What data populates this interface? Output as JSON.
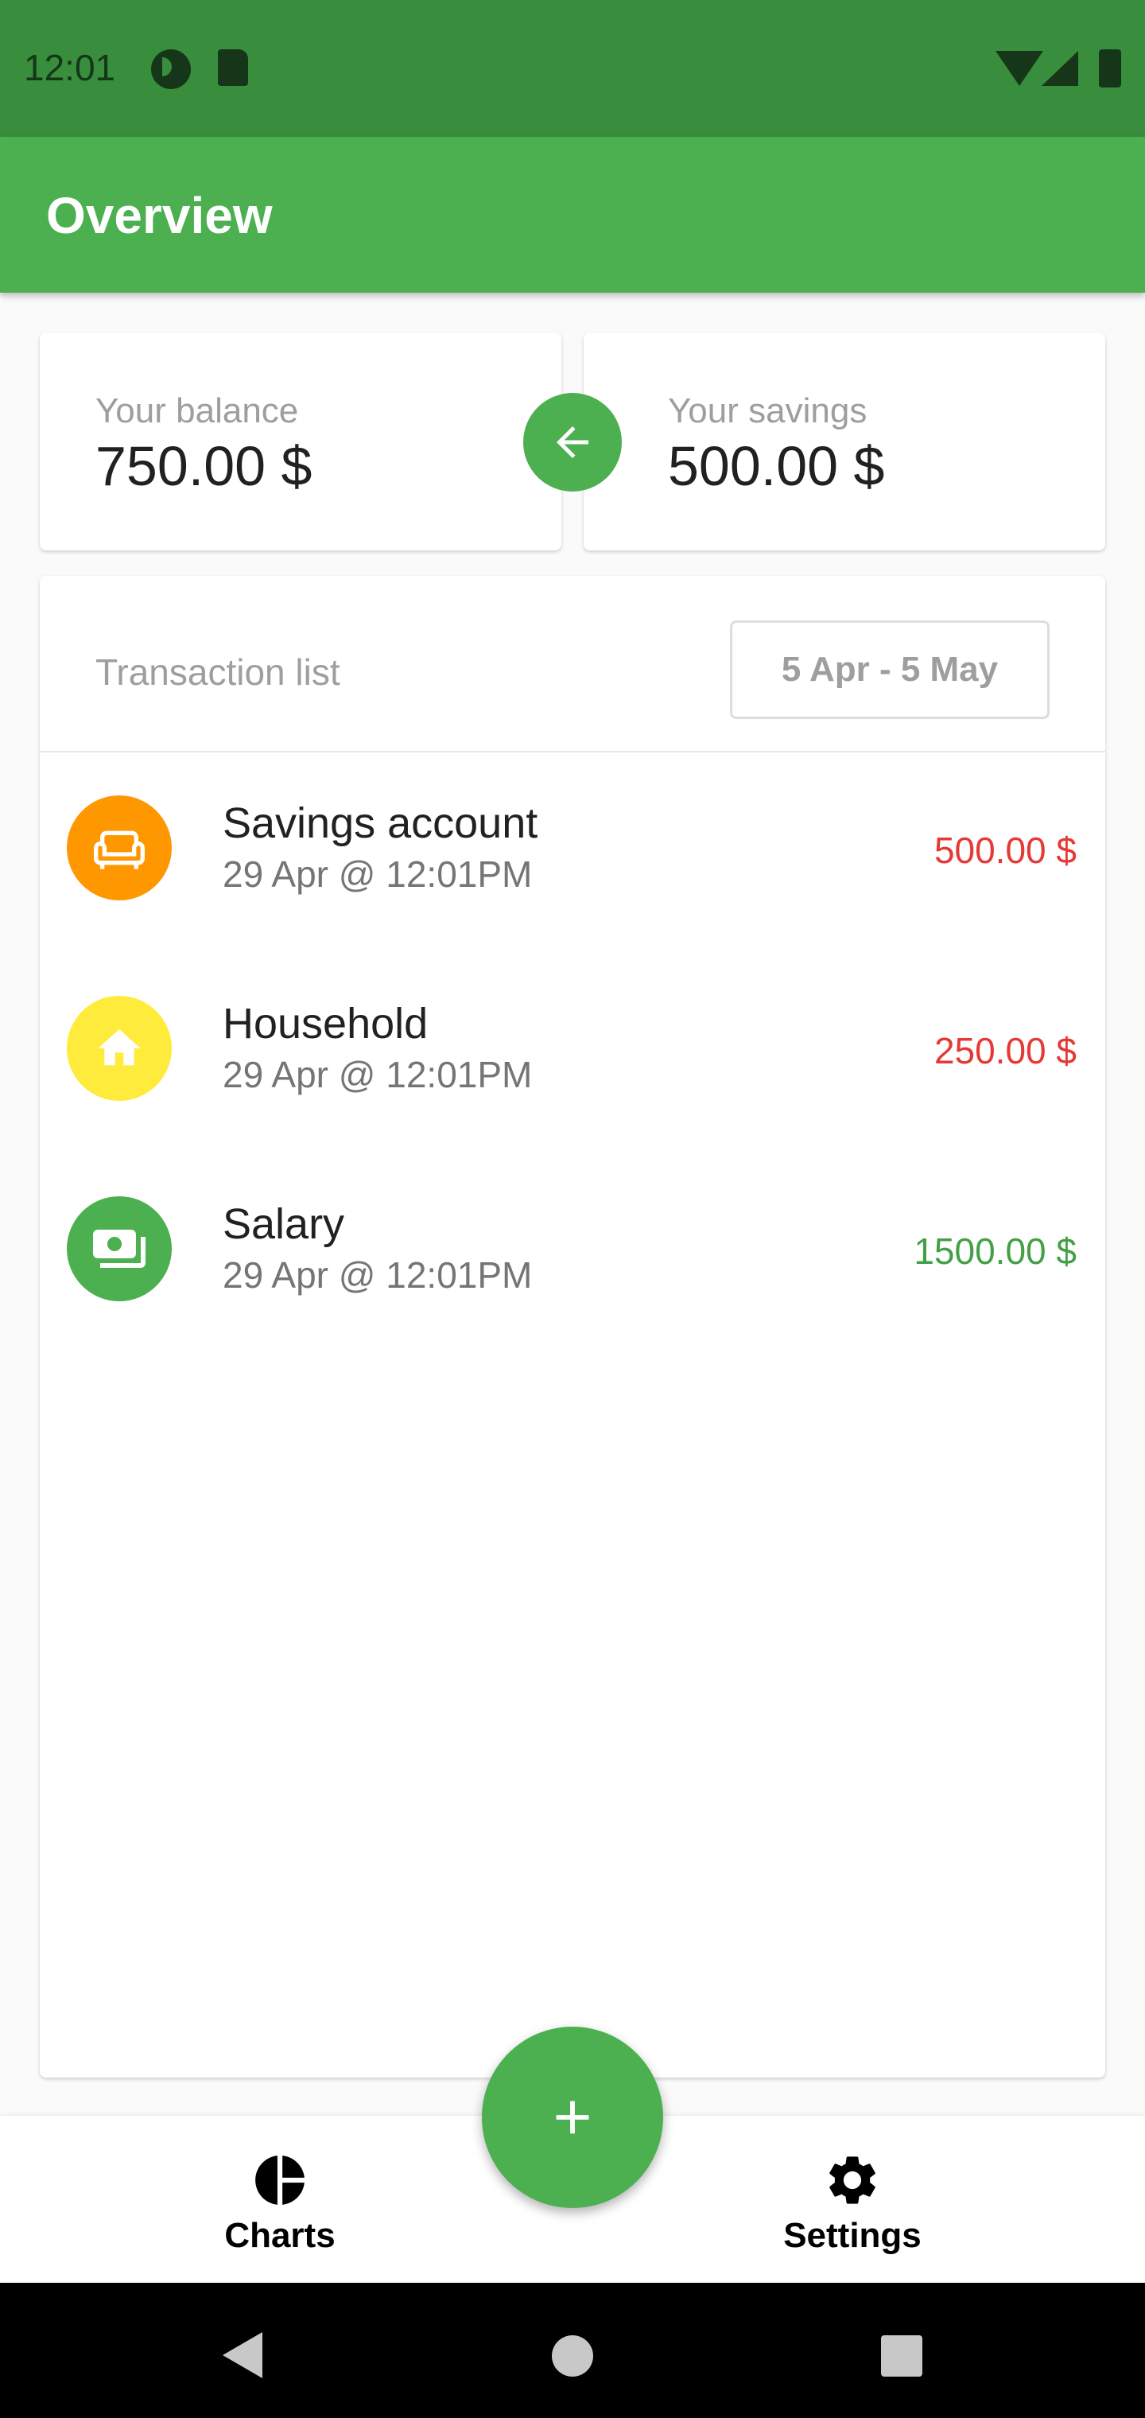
{
  "status_bar": {
    "time": "12:01"
  },
  "app_bar": {
    "title": "Overview"
  },
  "balance_card": {
    "label": "Your balance",
    "value": "750.00 $"
  },
  "savings_card": {
    "label": "Your savings",
    "value": "500.00 $"
  },
  "transaction_list": {
    "title": "Transaction list",
    "date_range": "5 Apr - 5 May",
    "items": [
      {
        "name": "Savings account",
        "date": "29 Apr @ 12:01PM",
        "amount": "500.00 $",
        "icon": "sofa-icon",
        "icon_color": "#ff9800",
        "type": "expense"
      },
      {
        "name": "Household",
        "date": "29 Apr @ 12:01PM",
        "amount": "250.00 $",
        "icon": "home-icon",
        "icon_color": "#ffeb3b",
        "type": "expense"
      },
      {
        "name": "Salary",
        "date": "29 Apr @ 12:01PM",
        "amount": "1500.00 $",
        "icon": "money-icon",
        "icon_color": "#4caf50",
        "type": "income"
      }
    ]
  },
  "bottom_nav": {
    "charts_label": "Charts",
    "settings_label": "Settings"
  },
  "colors": {
    "primary": "#4caf50",
    "primary_dark": "#388e3c",
    "expense": "#e53935",
    "income": "#43a047"
  }
}
